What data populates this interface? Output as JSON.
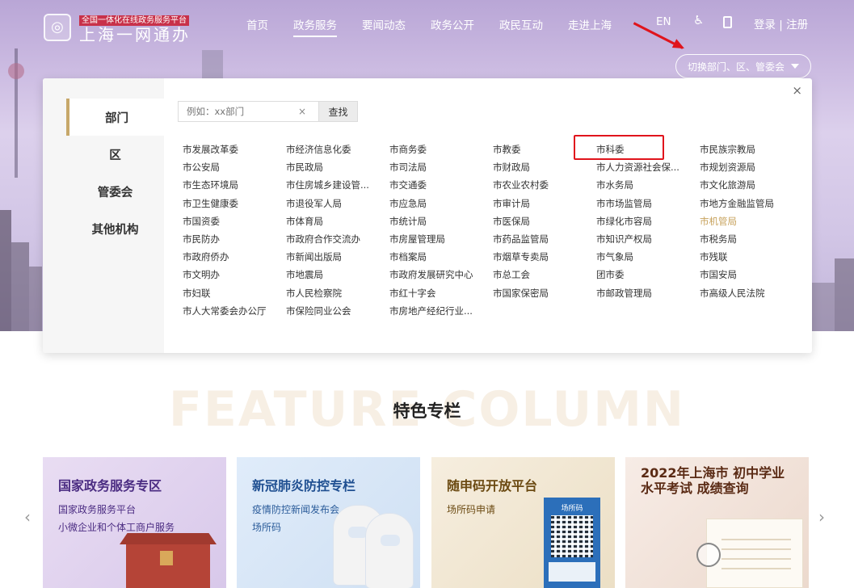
{
  "header": {
    "logo_icon": "emblem-icon",
    "logo_subtitle": "全国一体化在线政务服务平台",
    "logo_title": "上海一网通办",
    "nav": [
      "首页",
      "政务服务",
      "要闻动态",
      "政务公开",
      "政民互动",
      "走进上海"
    ],
    "nav_active_index": 1,
    "lang": "EN",
    "login": "登录 | 注册",
    "switch_label": "切换部门、区、管委会"
  },
  "panel": {
    "side_tabs": [
      "部门",
      "区",
      "管委会",
      "其他机构"
    ],
    "active_tab": 0,
    "search_placeholder": "例如：xx部门",
    "search_clear": "×",
    "search_button": "查找",
    "close": "×",
    "departments": [
      "市发展改革委",
      "市经济信息化委",
      "市商务委",
      "市教委",
      "市科委",
      "市民族宗教局",
      "市公安局",
      "市民政局",
      "市司法局",
      "市财政局",
      "市人力资源社会保...",
      "市规划资源局",
      "市生态环境局",
      "市住房城乡建设管...",
      "市交通委",
      "市农业农村委",
      "市水务局",
      "市文化旅游局",
      "市卫生健康委",
      "市退役军人局",
      "市应急局",
      "市审计局",
      "市市场监管局",
      "市地方金融监管局",
      "市国资委",
      "市体育局",
      "市统计局",
      "市医保局",
      "市绿化市容局",
      "市机管局",
      "市民防办",
      "市政府合作交流办",
      "市房屋管理局",
      "市药品监管局",
      "市知识产权局",
      "市税务局",
      "市政府侨办",
      "市新闻出版局",
      "市档案局",
      "市烟草专卖局",
      "市气象局",
      "市残联",
      "市文明办",
      "市地震局",
      "市政府发展研究中心",
      "市总工会",
      "团市委",
      "市国安局",
      "市妇联",
      "市人民检察院",
      "市红十字会",
      "市国家保密局",
      "市邮政管理局",
      "市高级人民法院",
      "市人大常委会办公厅",
      "市保险同业公会",
      "市房地产经纪行业..."
    ],
    "highlighted_index": 29,
    "highlight_color": "#c7a25c"
  },
  "feature": {
    "bg_text": "FEATURE COLUMN",
    "title": "特色专栏",
    "prev": "‹",
    "next": "›",
    "cards": [
      {
        "title": "国家政务服务专区",
        "lines": [
          "国家政务服务平台",
          "小微企业和个体工商户服务"
        ]
      },
      {
        "title": "新冠肺炎防控专栏",
        "lines": [
          "疫情防控新闻发布会",
          "场所码"
        ]
      },
      {
        "title": "随申码开放平台",
        "lines": [
          "场所码申请"
        ],
        "poster_title": "场所码"
      },
      {
        "title": "2022年上海市 初中学业水平考试 成绩查询",
        "lines": []
      }
    ]
  },
  "colors": {
    "annotation_red": "#e0141c",
    "accent_gold": "#c7a86a"
  }
}
